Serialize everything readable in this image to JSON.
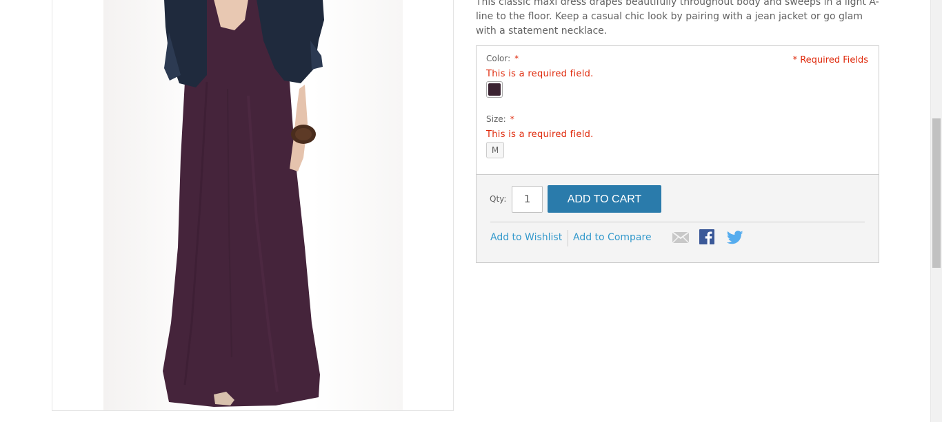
{
  "product": {
    "description": "This classic maxi dress drapes beautifully throughout body and sweeps in a light A-line to the floor. Keep a casual chic look by pairing with a jean jacket or go glam with a statement necklace.",
    "image_icon": "maxi-dress-photo"
  },
  "options": {
    "required_note": "* Required Fields",
    "color": {
      "label": "Color:",
      "star": "*",
      "error": "This is a required field.",
      "swatch_color": "#3a2231"
    },
    "size": {
      "label": "Size:",
      "star": "*",
      "error": "This is a required field.",
      "swatch_label": "M"
    }
  },
  "cart": {
    "qty_label": "Qty:",
    "qty_value": "1",
    "add_to_cart_label": "ADD TO CART",
    "wishlist_label": "Add to Wishlist",
    "compare_label": "Add to Compare",
    "share_icons": [
      "email-icon",
      "facebook-icon",
      "twitter-icon"
    ]
  },
  "colors": {
    "accent": "#3399cc",
    "button": "#2a7bab",
    "error": "#df280a"
  }
}
